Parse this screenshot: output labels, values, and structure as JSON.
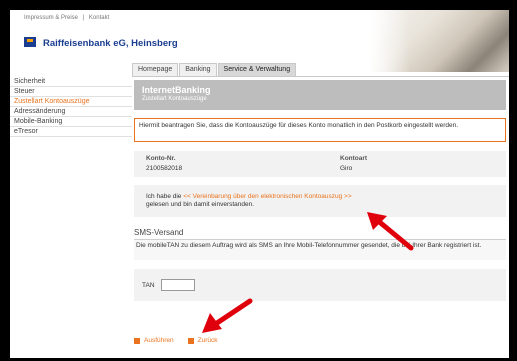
{
  "top_links": {
    "impressum": "Impressum & Preise",
    "separator": "|",
    "kontakt": "Kontakt"
  },
  "header": {
    "bank_name": "Raiffeisenbank eG, Heinsberg"
  },
  "tabs": [
    {
      "label": "Homepage"
    },
    {
      "label": "Banking"
    },
    {
      "label": "Service & Verwaltung"
    }
  ],
  "sidebar": {
    "items": [
      {
        "label": "Sicherheit"
      },
      {
        "label": "Steuer"
      },
      {
        "label": "Zustellart Kontoauszüge"
      },
      {
        "label": "Adressänderung"
      },
      {
        "label": "Mobile-Banking"
      },
      {
        "label": "eTresor"
      }
    ]
  },
  "main": {
    "title": "InternetBanking",
    "subtitle": "Zustellart Kontoauszüge",
    "notice": "Hiermit beantragen Sie, dass die Kontoauszüge für dieses Konto monatlich in den Postkorb eingestellt werden.",
    "accounts": {
      "col_number": "Konto-Nr.",
      "col_type": "Kontoart",
      "number": "2100582018",
      "type": "Giro"
    },
    "consent": {
      "prefix": "Ich habe die ",
      "link": "<< Vereinbarung über den elektronischen Kontoauszug >>",
      "suffix": "gelesen und bin damit einverstanden."
    },
    "sms": {
      "title": "SMS-Versand",
      "text": "Die mobileTAN zu diesem Auftrag wird als SMS an Ihre Mobil-Telefonnummer gesendet, die bei Ihrer Bank registriert ist."
    },
    "tan": {
      "label": "TAN",
      "value": ""
    },
    "actions": {
      "execute": "Ausführen",
      "back": "Zurück"
    }
  },
  "colors": {
    "accent": "#e9731e",
    "brand": "#1a3d8f",
    "arrow": "#e0000c"
  }
}
